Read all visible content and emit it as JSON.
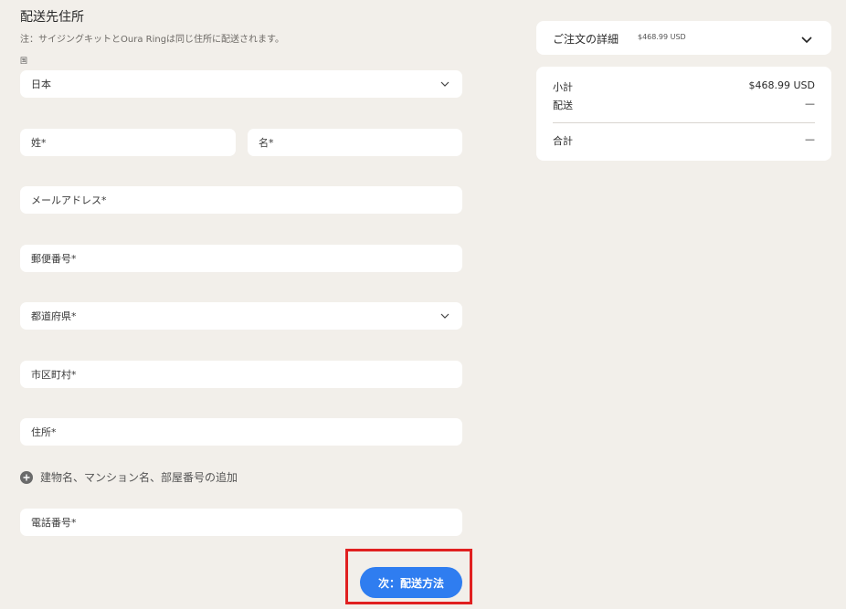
{
  "shipping": {
    "title": "配送先住所",
    "note": "注：サイジングキットとOura Ringは同じ住所に配送されます。",
    "country_label": "国",
    "country_value": "日本",
    "last_name": "姓*",
    "first_name": "名*",
    "email": "メールアドレス*",
    "postal_code": "郵便番号*",
    "prefecture": "都道府県*",
    "city": "市区町村*",
    "address": "住所*",
    "add_building": "建物名、マンション名、部屋番号の追加",
    "phone": "電話番号*",
    "next_button": "次：配送方法"
  },
  "order": {
    "details_label": "ご注文の詳細",
    "details_amount": "$468.99 USD",
    "subtotal_label": "小計",
    "subtotal_value": "$468.99 USD",
    "shipping_label": "配送",
    "shipping_value": "—",
    "total_label": "合計",
    "total_value": "—"
  },
  "colors": {
    "background": "#f2efea",
    "accent": "#2f7df0",
    "highlight": "#e02020"
  }
}
